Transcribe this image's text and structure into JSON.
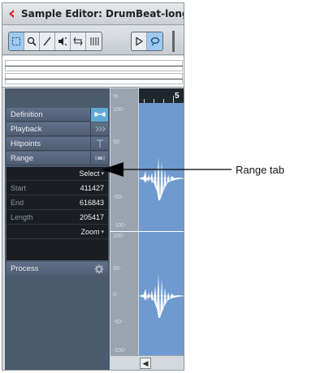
{
  "window": {
    "title": "Sample Editor: DrumBeat-long"
  },
  "toolbar": {
    "tools": [
      "range-selection-icon",
      "zoom-icon",
      "draw-icon",
      "audition-icon",
      "scrub-icon",
      "hitpoint-icon",
      "play-icon",
      "loop-icon"
    ]
  },
  "ruler": {
    "bar_label": "5"
  },
  "amplitude_scale": {
    "top_channel": [
      "%",
      "100-",
      "50-",
      "0-",
      "-50-",
      "-100-"
    ],
    "bottom_channel": [
      "100-",
      "50-",
      "0-",
      "-50-",
      "-100-"
    ]
  },
  "inspector": {
    "tabs": [
      {
        "label": "Definition",
        "icon": "definition-icon",
        "active": true
      },
      {
        "label": "Playback",
        "icon": "playback-icon",
        "active": false
      },
      {
        "label": "Hitpoints",
        "icon": "hitpoints-icon",
        "active": false
      },
      {
        "label": "Range",
        "icon": "range-icon",
        "active": false
      }
    ],
    "range": {
      "select_label": "Select",
      "start_label": "Start",
      "start_value": "411427",
      "end_label": "End",
      "end_value": "616843",
      "length_label": "Length",
      "length_value": "205417",
      "zoom_label": "Zoom"
    },
    "process_label": "Process"
  },
  "callout": {
    "text": "Range tab"
  },
  "colors": {
    "inspector_bg": "#4b5b6d",
    "range_panel_bg": "#1a1e23",
    "waveform_bg": "#6f9ad0",
    "active_tab_icon": "#5fa8d8"
  }
}
